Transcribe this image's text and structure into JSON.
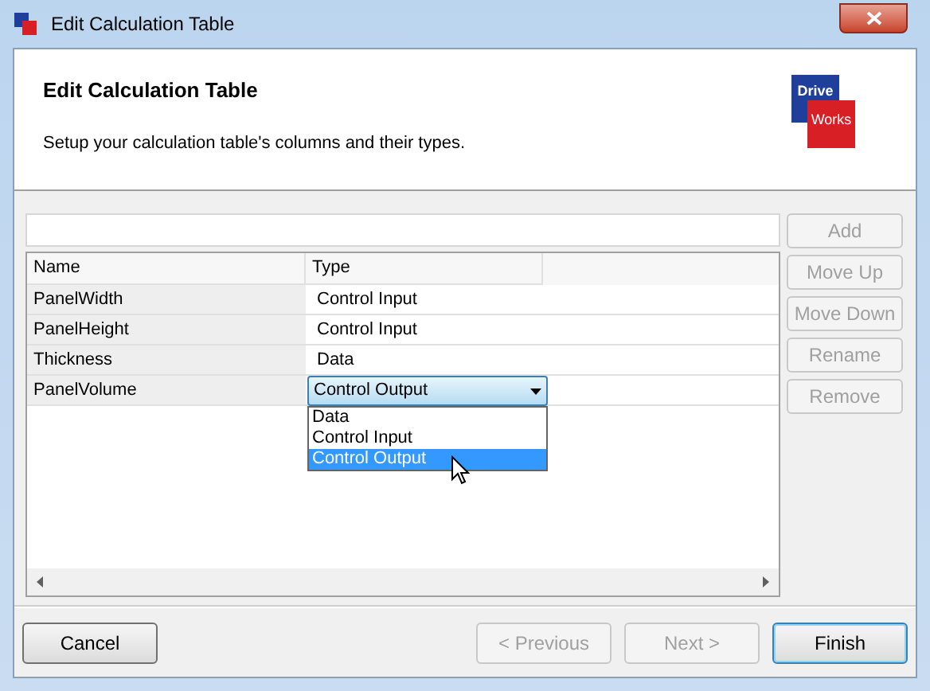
{
  "window": {
    "title": "Edit Calculation Table"
  },
  "header": {
    "title": "Edit Calculation Table",
    "subtitle": "Setup your calculation table's columns and their types.",
    "logo": [
      "Drive",
      "Works"
    ]
  },
  "side_buttons": [
    {
      "label": "Add",
      "disabled": true
    },
    {
      "label": "Move Up",
      "disabled": true
    },
    {
      "label": "Move Down",
      "disabled": true
    },
    {
      "label": "Rename",
      "disabled": true
    },
    {
      "label": "Remove",
      "disabled": true
    }
  ],
  "table": {
    "columns": [
      "Name",
      "Type"
    ],
    "rows": [
      {
        "name": "PanelWidth",
        "type": "Control Input",
        "editing": false
      },
      {
        "name": "PanelHeight",
        "type": "Control Input",
        "editing": false
      },
      {
        "name": "Thickness",
        "type": "Data",
        "editing": false
      },
      {
        "name": "PanelVolume",
        "type": "Control Output",
        "editing": true
      }
    ]
  },
  "dropdown": {
    "options": [
      {
        "label": "Data",
        "selected": false
      },
      {
        "label": "Control Input",
        "selected": false
      },
      {
        "label": "Control Output",
        "selected": true
      }
    ]
  },
  "footer_buttons": [
    {
      "label": "Cancel",
      "disabled": false,
      "default": false
    },
    {
      "label": "< Previous",
      "disabled": true,
      "default": false
    },
    {
      "label": "Next >",
      "disabled": true,
      "default": false
    },
    {
      "label": "Finish",
      "disabled": false,
      "default": true
    }
  ]
}
